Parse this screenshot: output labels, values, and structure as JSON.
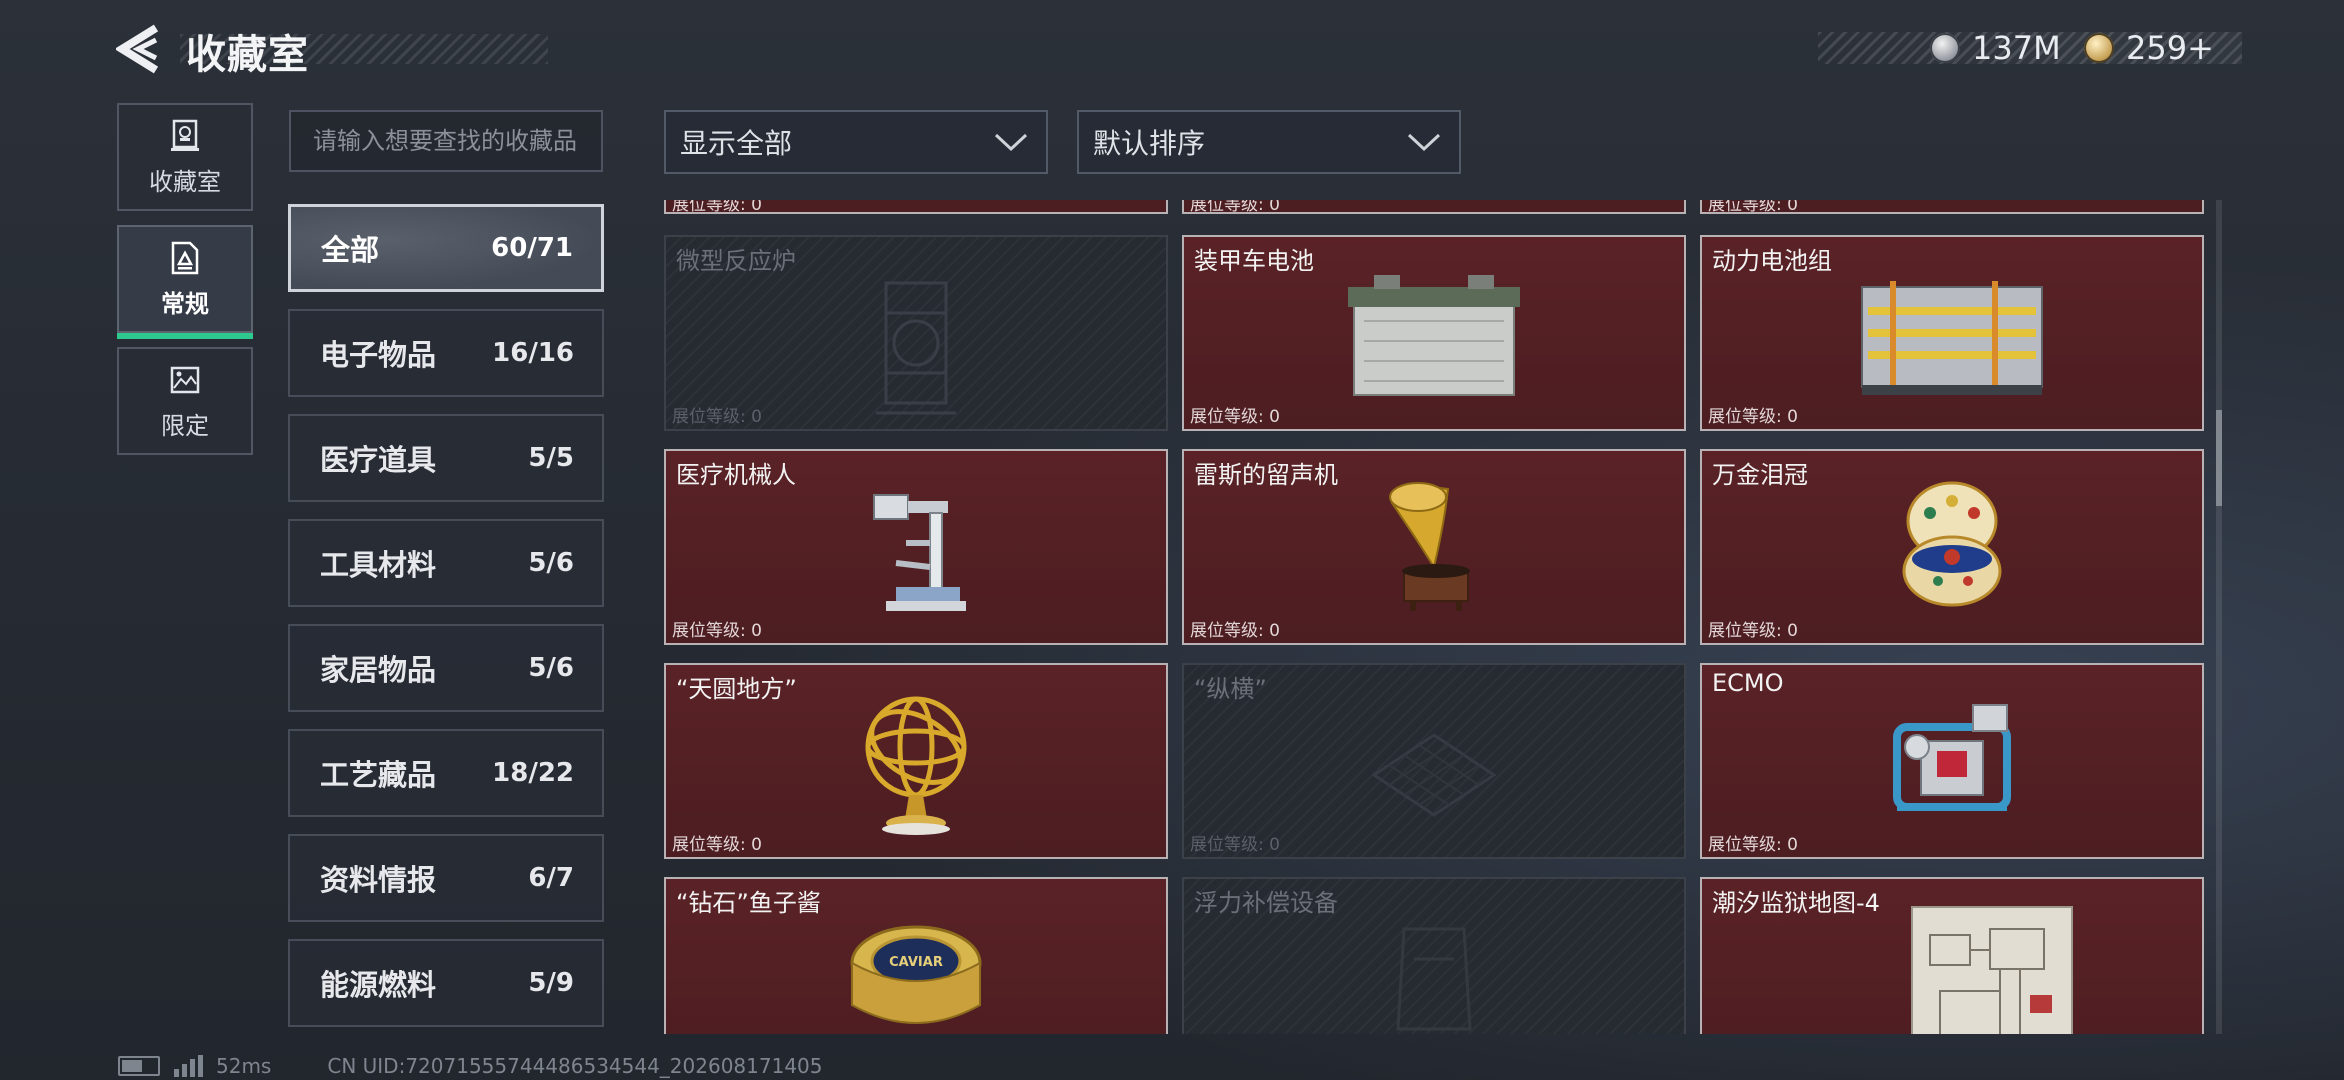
{
  "header": {
    "title": "收藏室"
  },
  "currencies": [
    {
      "icon": "silver-coin-icon",
      "amount": "137M"
    },
    {
      "icon": "gold-coin-icon",
      "amount": "259+"
    }
  ],
  "mode_tabs": [
    {
      "label": "收藏室",
      "icon": "trophy-icon",
      "active": false
    },
    {
      "label": "常规",
      "icon": "document-icon",
      "active": true
    },
    {
      "label": "限定",
      "icon": "limited-image-icon",
      "active": false
    }
  ],
  "search": {
    "placeholder": "请输入想要查找的收藏品"
  },
  "categories": [
    {
      "name": "全部",
      "count": "60/71",
      "active": true
    },
    {
      "name": "电子物品",
      "count": "16/16"
    },
    {
      "name": "医疗道具",
      "count": "5/5"
    },
    {
      "name": "工具材料",
      "count": "5/6"
    },
    {
      "name": "家居物品",
      "count": "5/6"
    },
    {
      "name": "工艺藏品",
      "count": "18/22"
    },
    {
      "name": "资料情报",
      "count": "6/7"
    },
    {
      "name": "能源燃料",
      "count": "5/9"
    }
  ],
  "filters": {
    "show": "显示全部",
    "sort": "默认排序"
  },
  "level_label": "展位等级: 0",
  "items": [
    {
      "name": "微型反应炉",
      "owned": false,
      "icon": "reactor-icon"
    },
    {
      "name": "装甲车电池",
      "owned": true,
      "icon": "battery-icon"
    },
    {
      "name": "动力电池组",
      "owned": true,
      "icon": "battery-pack-icon"
    },
    {
      "name": "医疗机械人",
      "owned": true,
      "icon": "medical-robot-icon"
    },
    {
      "name": "雷斯的留声机",
      "owned": true,
      "icon": "gramophone-icon"
    },
    {
      "name": "万金泪冠",
      "owned": true,
      "icon": "jeweled-egg-icon"
    },
    {
      "name": "“天圆地方”",
      "owned": true,
      "icon": "armillary-sphere-icon"
    },
    {
      "name": "“纵横”",
      "owned": false,
      "icon": "chessboard-icon"
    },
    {
      "name": "ECMO",
      "owned": true,
      "icon": "ecmo-machine-icon"
    },
    {
      "name": "“钻石”鱼子酱",
      "owned": true,
      "icon": "caviar-tin-icon",
      "tin_text": "CAVIAR"
    },
    {
      "name": "浮力补偿设备",
      "owned": false,
      "icon": "buoyancy-device-icon"
    },
    {
      "name": "潮汐监狱地图-4",
      "owned": true,
      "icon": "map-icon"
    }
  ],
  "footer": {
    "ping": "52ms",
    "uid": "CN UID:72071555744486534544_202608171405"
  },
  "colors": {
    "owned_card": "#4c1d21",
    "active_tab_accent": "#2ec98f"
  }
}
